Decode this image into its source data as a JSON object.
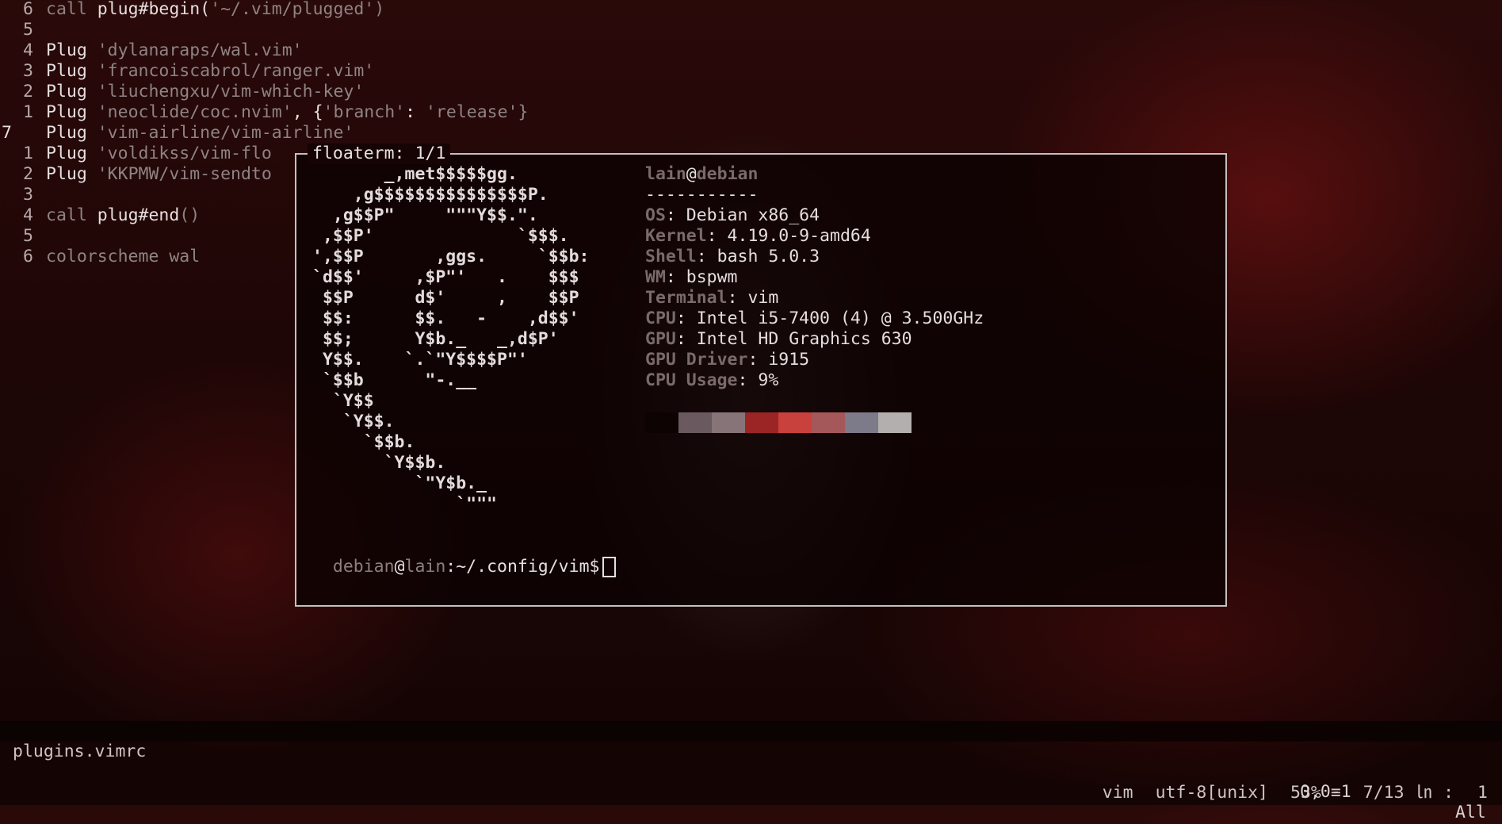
{
  "editor": {
    "lines": [
      {
        "num": "6",
        "current": false,
        "parts": [
          {
            "t": "call ",
            "c": "kw"
          },
          {
            "t": "plug#begin(",
            "c": "plain"
          },
          {
            "t": "'~/.vim/plugged'",
            "c": "str"
          },
          {
            "t": ")",
            "c": "kw"
          }
        ]
      },
      {
        "num": "5",
        "current": false,
        "parts": []
      },
      {
        "num": "4",
        "current": false,
        "parts": [
          {
            "t": "Plug ",
            "c": "plain"
          },
          {
            "t": "'dylanaraps/wal.vim'",
            "c": "str"
          }
        ]
      },
      {
        "num": "3",
        "current": false,
        "parts": [
          {
            "t": "Plug ",
            "c": "plain"
          },
          {
            "t": "'francoiscabrol/ranger.vim'",
            "c": "str"
          }
        ]
      },
      {
        "num": "2",
        "current": false,
        "parts": [
          {
            "t": "Plug ",
            "c": "plain"
          },
          {
            "t": "'liuchengxu/vim-which-key'",
            "c": "str"
          }
        ]
      },
      {
        "num": "1",
        "current": false,
        "parts": [
          {
            "t": "Plug ",
            "c": "plain"
          },
          {
            "t": "'neoclide/coc.nvim'",
            "c": "str"
          },
          {
            "t": ", {",
            "c": "plain"
          },
          {
            "t": "'branch'",
            "c": "str"
          },
          {
            "t": ": ",
            "c": "plain"
          },
          {
            "t": "'release'",
            "c": "str"
          },
          {
            "t": "}",
            "c": "kw"
          }
        ]
      },
      {
        "num": "7",
        "current": true,
        "parts": [
          {
            "t": "Plug ",
            "c": "plain"
          },
          {
            "t": "'vim-airline/vim-airline'",
            "c": "str"
          }
        ]
      },
      {
        "num": "1",
        "current": false,
        "parts": [
          {
            "t": "Plug ",
            "c": "plain"
          },
          {
            "t": "'voldikss/vim-flo",
            "c": "str"
          }
        ]
      },
      {
        "num": "2",
        "current": false,
        "parts": [
          {
            "t": "Plug ",
            "c": "plain"
          },
          {
            "t": "'KKPMW/vim-sendto",
            "c": "str"
          }
        ]
      },
      {
        "num": "3",
        "current": false,
        "parts": []
      },
      {
        "num": "4",
        "current": false,
        "parts": [
          {
            "t": "call ",
            "c": "kw"
          },
          {
            "t": "plug#end",
            "c": "plain"
          },
          {
            "t": "()",
            "c": "kw"
          }
        ]
      },
      {
        "num": "5",
        "current": false,
        "parts": []
      },
      {
        "num": "6",
        "current": false,
        "parts": [
          {
            "t": "colorscheme wal",
            "c": "kw"
          }
        ]
      }
    ]
  },
  "floaterm": {
    "title": "floaterm: 1/1",
    "ascii_art": "       _,met$$$$$gg.\n    ,g$$$$$$$$$$$$$$$P.\n  ,g$$P\"     \"\"\"Y$$.\".\n ,$$P'              `$$$.\n',$$P       ,ggs.     `$$b:\n`d$$'     ,$P\"'   .    $$$\n $$P      d$'     ,    $$P\n $$:      $$.   -    ,d$$'\n $$;      Y$b._   _,d$P'\n Y$$.    `.`\"Y$$$$P\"'\n `$$b      \"-.__\n  `Y$$\n   `Y$$.\n     `$$b.\n       `Y$$b.\n          `\"Y$b._\n              `\"\"\"",
    "user": "lain",
    "at": "@",
    "host": "debian",
    "separator": "-----------",
    "info": [
      {
        "key": "OS",
        "value": ": Debian x86_64"
      },
      {
        "key": "Kernel",
        "value": ": 4.19.0-9-amd64"
      },
      {
        "key": "Shell",
        "value": ": bash 5.0.3"
      },
      {
        "key": "WM",
        "value": ": bspwm"
      },
      {
        "key": "Terminal",
        "value": ": vim"
      },
      {
        "key": "CPU",
        "value": ": Intel i5-7400 (4) @ 3.500GHz"
      },
      {
        "key": "GPU",
        "value": ": Intel HD Graphics 630"
      },
      {
        "key": "GPU Driver",
        "value": ": i915"
      },
      {
        "key": "CPU Usage",
        "value": ": 9%"
      }
    ],
    "palette": [
      "#0e0303",
      "#6a5a5f",
      "#877478",
      "#9b2424",
      "#c9413c",
      "#a5585a",
      "#7d7a8a",
      "#b3afae"
    ],
    "prompt": {
      "user": "debian",
      "at": "@",
      "host": "lain",
      "path": ":~/.config/vim$"
    }
  },
  "statusline": {
    "filename": "plugins.vimrc",
    "filetype": "vim",
    "encoding": "utf-8[unix]",
    "percent": "53%",
    "menu_glyph": "≡",
    "position": "7/13",
    "ln_glyph": "㏑",
    "colon": ":",
    "column": "1"
  },
  "cmdline": {
    "ruler": "0,0-1",
    "scroll": "All"
  }
}
